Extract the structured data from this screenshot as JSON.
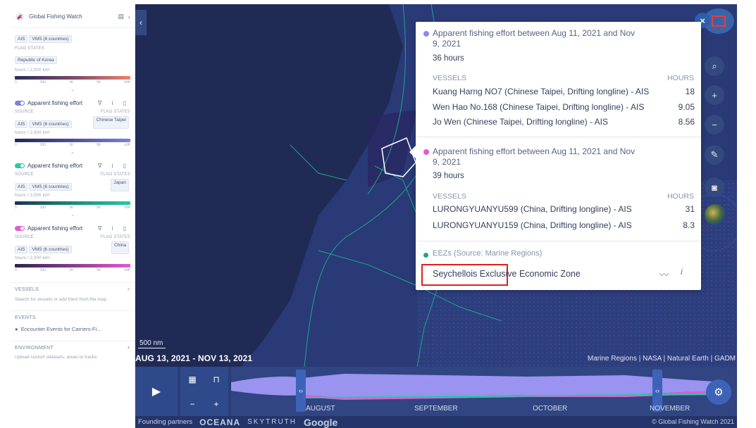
{
  "sidebar": {
    "app_title": "Global Fishing Watch",
    "top_layer": {
      "sources": [
        "AIS",
        "VMS (6 countries)"
      ],
      "flag_label": "FLAG STATES",
      "flag": "Republic of Korea",
      "unit": "hours / 2,000 km²",
      "ticks": [
        "0",
        "200",
        "1K",
        "5K",
        "≥9K"
      ],
      "colors": [
        "#2a2b5c",
        "#f0826c"
      ]
    },
    "layers": [
      {
        "name": "Apparent fishing effort",
        "source_label": "SOURCE",
        "flag_label": "FLAG STATES",
        "sources": [
          "AIS",
          "VMS (6 countries)"
        ],
        "flag": "Chinese Taipei",
        "unit": "hours / 2,000 km²",
        "ticks": [
          "0",
          "200",
          "1K",
          "5K",
          "≥9K"
        ],
        "color": "#7a7fe0"
      },
      {
        "name": "Apparent fishing effort",
        "source_label": "SOURCE",
        "flag_label": "FLAG STATES",
        "sources": [
          "AIS",
          "VMS (6 countries)"
        ],
        "flag": "Japan",
        "unit": "hours / 2,000 km²",
        "ticks": [
          "0",
          "200",
          "1K",
          "5K",
          "≥9K"
        ],
        "color": "#27c8a8"
      },
      {
        "name": "Apparent fishing effort",
        "source_label": "SOURCE",
        "flag_label": "FLAG STATES",
        "sources": [
          "AIS",
          "VMS (6 countries)"
        ],
        "flag": "China",
        "unit": "hours / 2,000 km²",
        "ticks": [
          "0",
          "200",
          "1K",
          "5K",
          "≥9K"
        ],
        "color": "#e15bd3"
      }
    ],
    "vessels": {
      "title": "VESSELS",
      "desc": "Search for vessels or add them from the map"
    },
    "events": {
      "title": "EVENTS",
      "item": "Encounter Events for Carriers-Fi..."
    },
    "environment": {
      "title": "ENVIRONMENT",
      "desc": "Upload custom datasets, areas or tracks"
    }
  },
  "map": {
    "scale": "500 nm",
    "date_range": "AUG 13, 2021 - NOV 13, 2021",
    "attribution": "Marine Regions | NASA | Natural Earth | GADM",
    "tools": {
      "close": "×",
      "search": "⌕",
      "zoom_in": "+",
      "zoom_out": "−",
      "ruler": "✎",
      "screenshot": "◙"
    }
  },
  "popup": {
    "sections": [
      {
        "color": "#8f86f3",
        "title": "Apparent fishing effort between Aug 11, 2021 and Nov 9, 2021",
        "hours": "36 hours",
        "vessels_label": "VESSELS",
        "hours_label": "HOURS",
        "vessels": [
          {
            "name": "Kuang Harng NO7 (Chinese Taipei, Drifting longline) - AIS",
            "hours": "18"
          },
          {
            "name": "Wen Hao No.168 (Chinese Taipei, Drifting longline) - AIS",
            "hours": "9.05"
          },
          {
            "name": "Jo Wen (Chinese Taipei, Drifting longline) - AIS",
            "hours": "8.56"
          }
        ]
      },
      {
        "color": "#e15bd3",
        "title": "Apparent fishing effort between Aug 11, 2021 and Nov 9, 2021",
        "hours": "39 hours",
        "vessels_label": "VESSELS",
        "hours_label": "HOURS",
        "vessels": [
          {
            "name": "LURONGYUANYU599 (China, Drifting longline) - AIS",
            "hours": "31"
          },
          {
            "name": "LURONGYUANYU159 (China, Drifting longline) - AIS",
            "hours": "8.3"
          }
        ]
      }
    ],
    "eez": {
      "color": "#1ea58a",
      "title": "EEZs (Source: Marine Regions)",
      "name": "Seychellois Exclusive Economic Zone"
    }
  },
  "timebar": {
    "months": [
      "AUGUST",
      "SEPTEMBER",
      "OCTOBER",
      "NOVEMBER"
    ],
    "footer_label": "Founding partners",
    "partners": [
      "OCEANA",
      "SKYTRUTH",
      "Google"
    ],
    "copyright": "© Global Fishing Watch 2021"
  }
}
